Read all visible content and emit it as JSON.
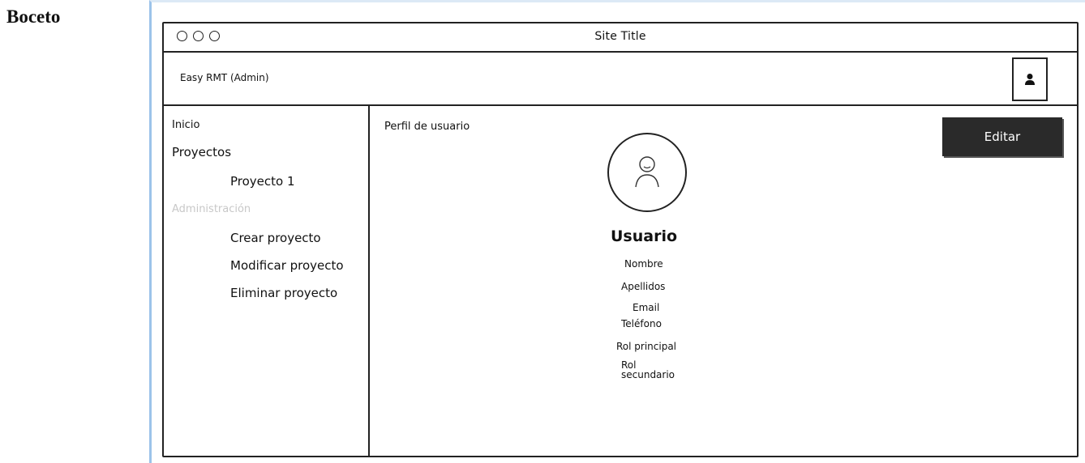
{
  "doc_label": "Boceto",
  "window": {
    "title": "Site Title",
    "controls": [
      "circle",
      "circle",
      "circle"
    ]
  },
  "header": {
    "app_name": "Easy RMT (Admin)",
    "user_icon": "user-icon"
  },
  "sidebar": {
    "items": [
      {
        "label": "Inicio"
      },
      {
        "label": "Proyectos"
      },
      {
        "label": "Proyecto 1"
      },
      {
        "label": "Administración",
        "state": "disabled"
      },
      {
        "label": "Crear proyecto"
      },
      {
        "label": "Modificar proyecto"
      },
      {
        "label": "Eliminar proyecto"
      }
    ]
  },
  "main": {
    "page_title": "Perfil de usuario",
    "edit_button": "Editar",
    "avatar_icon": "user-avatar-icon",
    "user_heading": "Usuario",
    "fields": {
      "nombre": "Nombre",
      "apellidos": "Apellidos",
      "email": "Email",
      "telefono": "Teléfono",
      "rol_principal": "Rol principal",
      "rol_secundario": "Rol secundario"
    }
  },
  "colors": {
    "button_bg": "#2a2a2a",
    "disabled_text": "#c8c8c8",
    "frame_accent": "#9cc3ea"
  }
}
